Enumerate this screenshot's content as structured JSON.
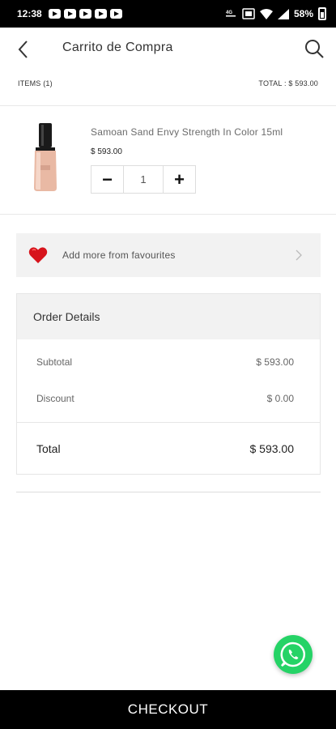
{
  "status_bar": {
    "time": "12:38",
    "battery": "58%",
    "network": "4G",
    "notification_icons": [
      "youtube-icon",
      "youtube-icon",
      "youtube-icon",
      "youtube-icon",
      "youtube-icon"
    ]
  },
  "header": {
    "title": "Carrito de Compra",
    "back_icon": "chevron-left-icon",
    "search_icon": "search-icon"
  },
  "summary": {
    "items": "ITEMS (1)",
    "total": "TOTAL : $ 593.00"
  },
  "cart": {
    "items": [
      {
        "name": "Samoan Sand Envy Strength In Color 15ml",
        "price": "$ 593.00",
        "quantity": "1",
        "minus": "−",
        "plus": "+"
      }
    ]
  },
  "favourites": {
    "label": "Add more from favourites",
    "icon": "heart-icon"
  },
  "order_details": {
    "title": "Order Details",
    "subtotal_label": "Subtotal",
    "subtotal_value": "$ 593.00",
    "discount_label": "Discount",
    "discount_value": "$ 0.00",
    "total_label": "Total",
    "total_value": "$ 593.00"
  },
  "checkout_label": "CHECKOUT",
  "colors": {
    "checkout_bg": "#000000",
    "whatsapp": "#25d366",
    "heart": "#d7141c",
    "panel_bg": "#f2f2f2"
  }
}
